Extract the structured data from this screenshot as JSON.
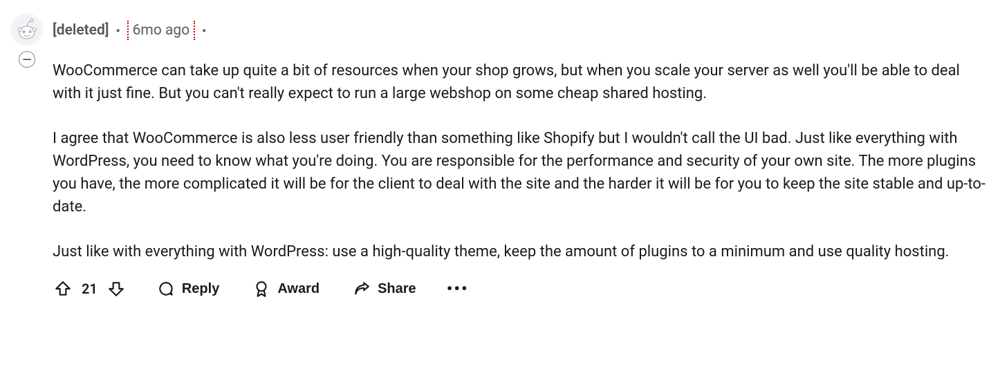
{
  "comment": {
    "author": "[deleted]",
    "time": "6mo ago",
    "paragraphs": [
      "WooCommerce can take up quite a bit of resources when your shop grows, but when you scale your server as well you'll be able to deal with it just fine. But you can't really expect to run a large webshop on some cheap shared hosting.",
      "I agree that WooCommerce is also less user friendly than something like Shopify but I wouldn't call the UI bad. Just like everything with WordPress, you need to know what you're doing. You are responsible for the performance and security of your own site. The more plugins you have, the more complicated it will be for the client to deal with the site and the harder it will be for you to keep the site stable and up-to-date.",
      "Just like with everything with WordPress: use a high-quality theme, keep the amount of plugins to a minimum and use quality hosting."
    ],
    "score": "21",
    "actions": {
      "reply": "Reply",
      "award": "Award",
      "share": "Share"
    }
  }
}
